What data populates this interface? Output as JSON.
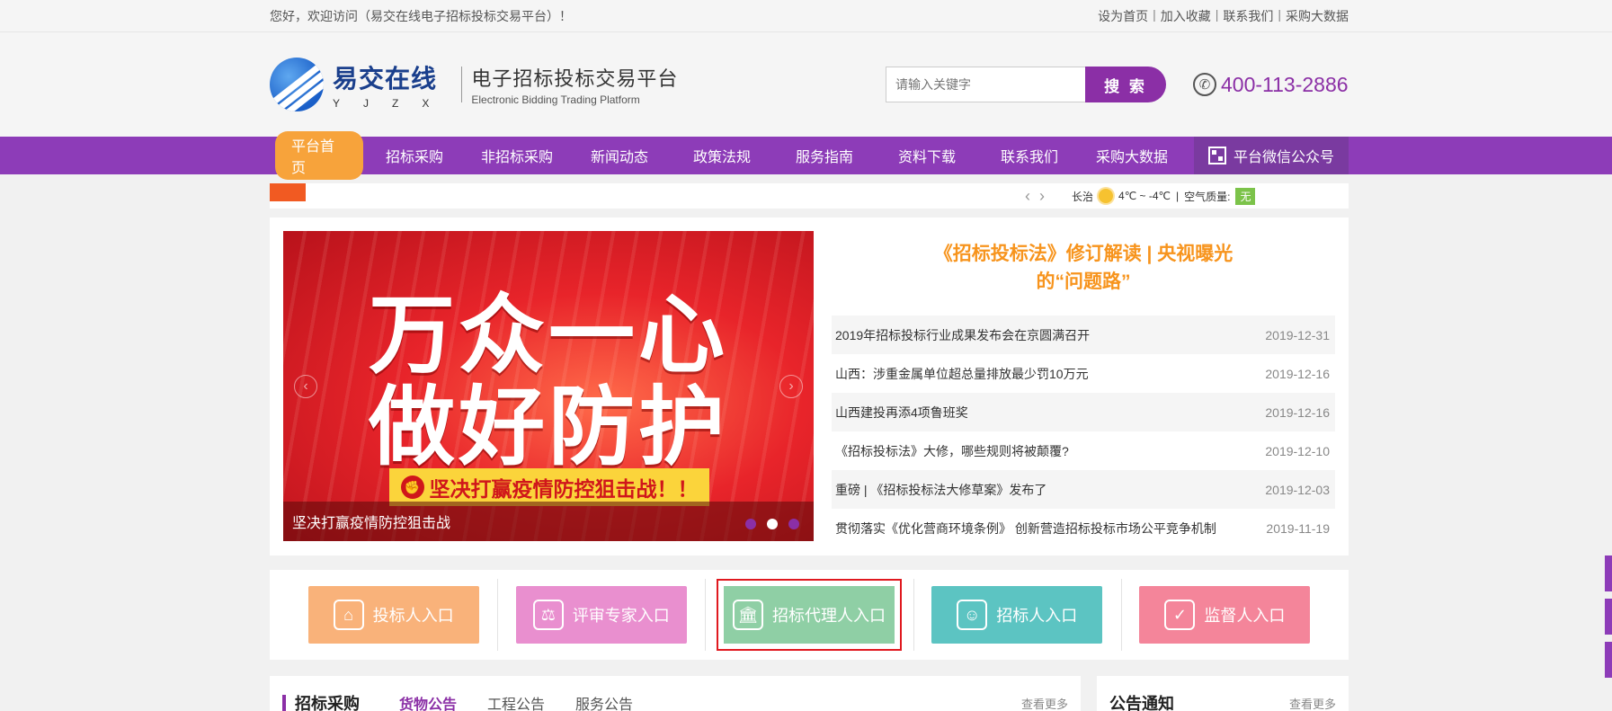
{
  "topbar": {
    "welcome": "您好，欢迎访问（易交在线电子招标投标交易平台）！",
    "links": [
      "设为首页",
      "加入收藏",
      "联系我们",
      "采购大数据"
    ]
  },
  "header": {
    "logo_cn": "易交在线",
    "logo_letters": "YJZX",
    "platform_cn": "电子招标投标交易平台",
    "platform_en": "Electronic Bidding Trading Platform",
    "search_placeholder": "请输入关键字",
    "search_button": "搜 索",
    "phone": "400-113-2886"
  },
  "nav": {
    "items": [
      "平台首页",
      "招标采购",
      "非招标采购",
      "新闻动态",
      "政策法规",
      "服务指南",
      "资料下载",
      "联系我们",
      "采购大数据"
    ],
    "wechat": "平台微信公众号"
  },
  "ticker": {
    "city": "长治",
    "temp": "4℃ ~ -4℃",
    "aq_label": "空气质量:",
    "aq_value": "无"
  },
  "banner": {
    "line1": "万众一心",
    "line2": "做好防护",
    "slogan": "坚决打赢疫情防控狙击战！！",
    "caption": "坚决打赢疫情防控狙击战"
  },
  "news": {
    "headline_1": "《招标投标法》修订解读 | 央视曝光",
    "headline_2": "的“问题路”",
    "items": [
      {
        "title": "2019年招标投标行业成果发布会在京圆满召开",
        "date": "2019-12-31"
      },
      {
        "title": "山西：涉重金属单位超总量排放最少罚10万元",
        "date": "2019-12-16"
      },
      {
        "title": "山西建投再添4项鲁班奖",
        "date": "2019-12-16"
      },
      {
        "title": "《招标投标法》大修，哪些规则将被颠覆?",
        "date": "2019-12-10"
      },
      {
        "title": "重磅 | 《招标投标法大修草案》发布了",
        "date": "2019-12-03"
      },
      {
        "title": "贯彻落实《优化营商环境条例》 创新营造招标投标市场公平竞争机制",
        "date": "2019-11-19"
      }
    ]
  },
  "entries": [
    {
      "label": "投标人入口",
      "color": "#f9b27a",
      "icon": "store-icon"
    },
    {
      "label": "评审专家入口",
      "color": "#e98fcf",
      "icon": "scale-icon"
    },
    {
      "label": "招标代理人入口",
      "color": "#8fcfa5",
      "icon": "bank-icon"
    },
    {
      "label": "招标人入口",
      "color": "#5cc4c2",
      "icon": "user-icon"
    },
    {
      "label": "监督人入口",
      "color": "#f4859a",
      "icon": "shield-icon"
    }
  ],
  "sections": {
    "procurement_title": "招标采购",
    "tabs": [
      "货物公告",
      "工程公告",
      "服务公告"
    ],
    "more": "查看更多",
    "notice_title": "公告通知",
    "notice_more": "查看更多"
  }
}
